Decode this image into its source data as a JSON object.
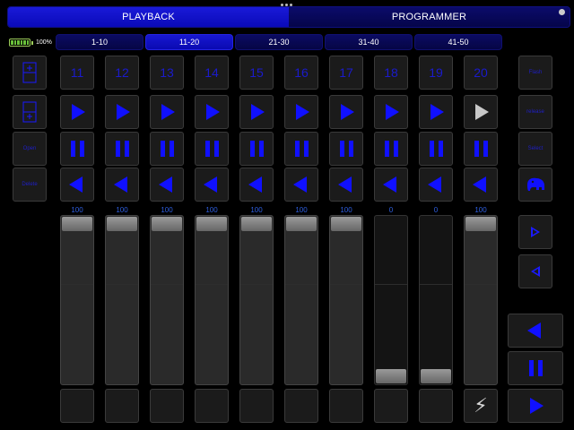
{
  "header": {
    "tabs": [
      {
        "label": "PLAYBACK",
        "active": true
      },
      {
        "label": "PROGRAMMER",
        "active": false
      }
    ]
  },
  "battery": {
    "percent_label": "100%",
    "level": 1.0,
    "color": "#6ac13a"
  },
  "page_tabs": [
    {
      "label": "1-10",
      "active": false
    },
    {
      "label": "11-20",
      "active": true
    },
    {
      "label": "21-30",
      "active": false
    },
    {
      "label": "31-40",
      "active": false
    },
    {
      "label": "41-50",
      "active": false
    }
  ],
  "left_controls": {
    "open_label": "Open",
    "delete_label": "Delete"
  },
  "right_controls": {
    "flash_label": "Flash",
    "release_label": "release",
    "select_label": "Select"
  },
  "playbacks": [
    {
      "number": "11",
      "level_label": "100",
      "level": 1.0,
      "running": false
    },
    {
      "number": "12",
      "level_label": "100",
      "level": 1.0,
      "running": false
    },
    {
      "number": "13",
      "level_label": "100",
      "level": 1.0,
      "running": false
    },
    {
      "number": "14",
      "level_label": "100",
      "level": 1.0,
      "running": false
    },
    {
      "number": "15",
      "level_label": "100",
      "level": 1.0,
      "running": false
    },
    {
      "number": "16",
      "level_label": "100",
      "level": 1.0,
      "running": false
    },
    {
      "number": "17",
      "level_label": "100",
      "level": 1.0,
      "running": false
    },
    {
      "number": "18",
      "level_label": "0",
      "level": 0.0,
      "running": false
    },
    {
      "number": "19",
      "level_label": "0",
      "level": 0.0,
      "running": false
    },
    {
      "number": "20",
      "level_label": "100",
      "level": 1.0,
      "running": true
    }
  ],
  "colors": {
    "accent": "#1010ff",
    "active_tab": "#1a1ad8",
    "inactive_tab": "#0b0b62",
    "go_running": "#c8c8c8"
  }
}
